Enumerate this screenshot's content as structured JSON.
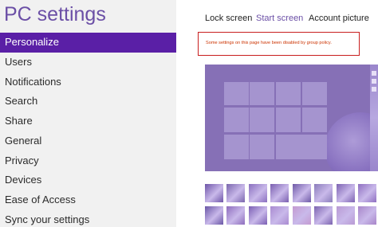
{
  "app": {
    "title": "PC settings"
  },
  "nav": {
    "items": [
      {
        "label": "Personalize",
        "selected": true
      },
      {
        "label": "Users"
      },
      {
        "label": "Notifications"
      },
      {
        "label": "Search"
      },
      {
        "label": "Share"
      },
      {
        "label": "General"
      },
      {
        "label": "Privacy"
      },
      {
        "label": "Devices"
      },
      {
        "label": "Ease of Access"
      },
      {
        "label": "Sync your settings"
      }
    ]
  },
  "tabs": [
    {
      "label": "Lock screen"
    },
    {
      "label": "Start screen",
      "active": true
    },
    {
      "label": "Account picture"
    }
  ],
  "notice": {
    "text": "Some settings on this page have been disabled by group policy."
  },
  "colors": {
    "accent": "#5a1fa6",
    "title": "#6b4fa6",
    "notice_border": "#c81e1e",
    "notice_text": "#cc3300",
    "preview_bg": "#8670b6"
  },
  "thumbnails": [
    {
      "color": "#6e55a8"
    },
    {
      "color": "#7a66ad"
    },
    {
      "color": "#8a6fbf"
    },
    {
      "color": "#7a5fb0"
    },
    {
      "color": "#6f5aa7"
    },
    {
      "color": "#8b7dbb"
    },
    {
      "color": "#7d63b2"
    },
    {
      "color": "#8f6fc1"
    },
    {
      "color": "#6a56a6"
    },
    {
      "color": "#8e6dbd"
    },
    {
      "color": "#7b5fb4"
    },
    {
      "color": "#a98bd1"
    },
    {
      "color": "#c49ad1"
    },
    {
      "color": "#7c64b0"
    },
    {
      "color": "#b99ad4"
    },
    {
      "color": "#a885c9"
    }
  ]
}
